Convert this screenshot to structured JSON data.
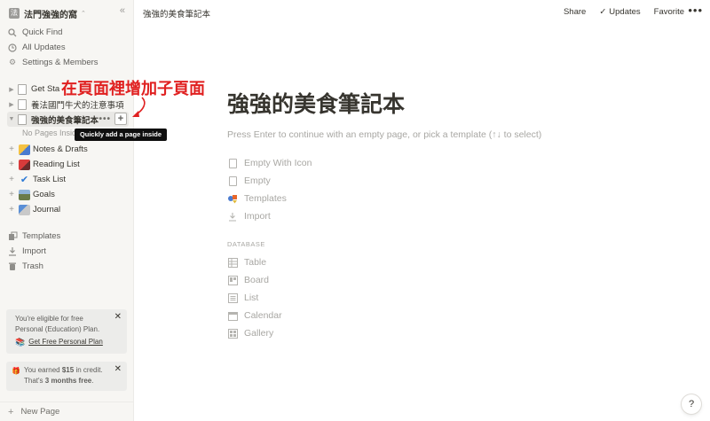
{
  "workspace": {
    "name": "法門強強的窩",
    "logo_char": "法"
  },
  "sidebar": {
    "nav": [
      "Quick Find",
      "All Updates",
      "Settings & Members"
    ],
    "tree": {
      "get_started": "Get Sta",
      "guide": "養法國鬥牛犬的注意事項",
      "active": "強強的美食筆記本",
      "no_pages": "No Pages Insid",
      "items": [
        "Notes & Drafts",
        "Reading List",
        "Task List",
        "Goals",
        "Journal"
      ]
    },
    "bottom_nav": [
      "Templates",
      "Import",
      "Trash"
    ],
    "card_education": {
      "text": "You're eligible for free Personal (Education) Plan.",
      "link": "Get Free Personal Plan"
    },
    "card_credit": {
      "prefix": "You earned ",
      "amount": "$15",
      "mid": " in credit. That's ",
      "months": "3 months free",
      "suffix": "."
    },
    "new_page": "New Page"
  },
  "tooltip": "Quickly add a page inside",
  "annotation": "在頁面裡增加子頁面",
  "topbar": {
    "breadcrumb": "強強的美食筆記本",
    "share": "Share",
    "updates": "Updates",
    "favorite": "Favorite"
  },
  "page": {
    "title": "強強的美食筆記本",
    "hint": "Press Enter to continue with an empty page, or pick a template (↑↓ to select)",
    "options": [
      "Empty With Icon",
      "Empty",
      "Templates",
      "Import"
    ],
    "database_label": "DATABASE",
    "database_options": [
      "Table",
      "Board",
      "List",
      "Calendar",
      "Gallery"
    ]
  },
  "colors": {
    "annotation": "#e02020",
    "sidebar_bg": "#f7f6f3",
    "tooltip_bg": "#0f0f0f"
  }
}
